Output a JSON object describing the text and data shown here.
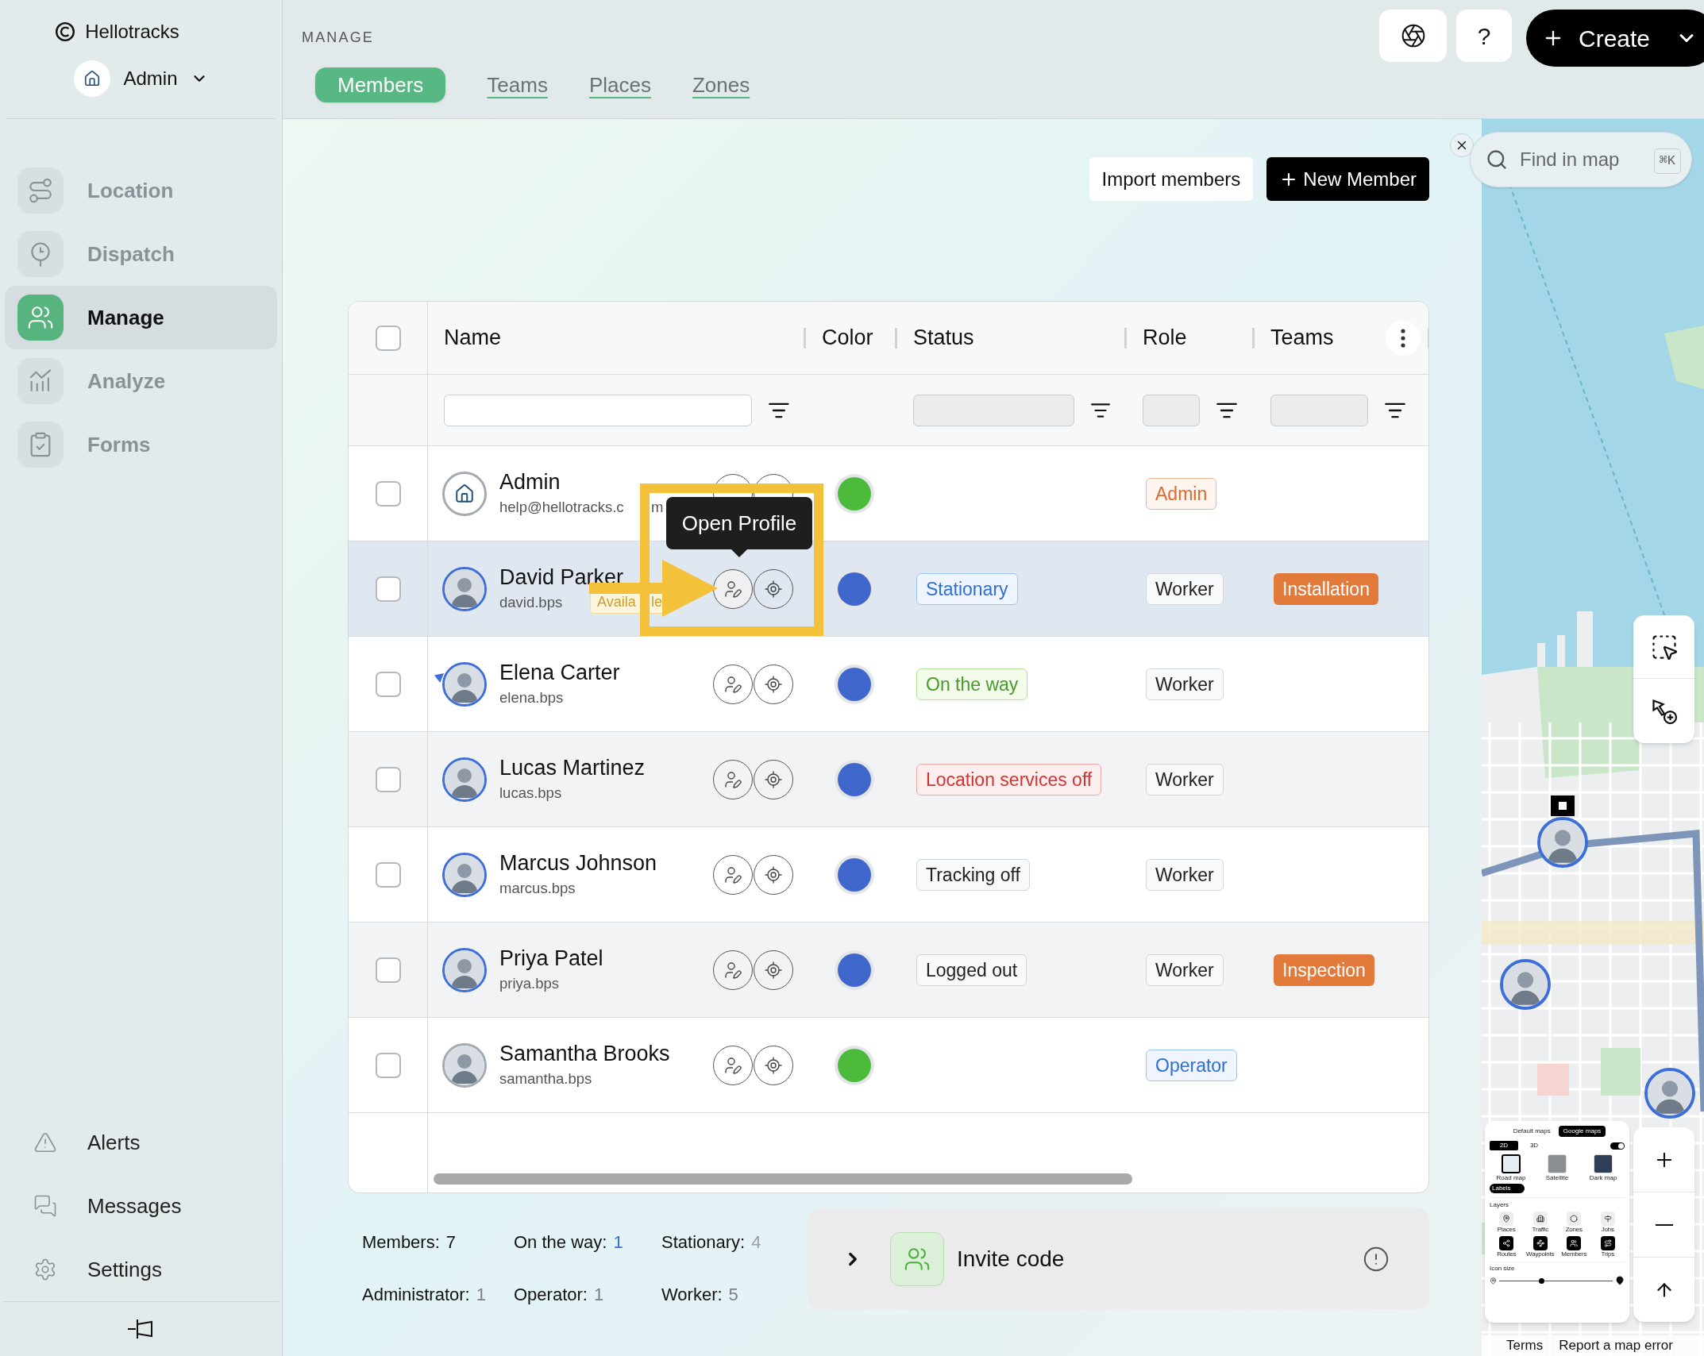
{
  "sidebar": {
    "brand": "Hellotracks",
    "account": "Admin",
    "nav": [
      {
        "label": "Location",
        "selected": false
      },
      {
        "label": "Dispatch",
        "selected": false
      },
      {
        "label": "Manage",
        "selected": true
      },
      {
        "label": "Analyze",
        "selected": false
      },
      {
        "label": "Forms",
        "selected": false
      }
    ],
    "footer_nav": [
      {
        "label": "Alerts"
      },
      {
        "label": "Messages"
      },
      {
        "label": "Settings"
      }
    ]
  },
  "header": {
    "section": "MANAGE",
    "tabs": [
      {
        "label": "Members",
        "selected": true
      },
      {
        "label": "Teams",
        "selected": false
      },
      {
        "label": "Places",
        "selected": false
      },
      {
        "label": "Zones",
        "selected": false
      }
    ],
    "help": "?",
    "create": "Create"
  },
  "actions": {
    "import": "Import members",
    "new_member": "New Member"
  },
  "table": {
    "select_all_checked": false,
    "columns": [
      {
        "label": "Name",
        "filter_disabled": false
      },
      {
        "label": "Color"
      },
      {
        "label": "Status",
        "filter_disabled": true
      },
      {
        "label": "Role",
        "filter_disabled": true
      },
      {
        "label": "Teams",
        "filter_disabled": true
      }
    ],
    "rows": [
      {
        "name": "Admin",
        "subtitle_parts": [
          "help@hellotracks.c",
          "m"
        ],
        "checked": false,
        "selected": false,
        "avatar": {
          "kind": "logo",
          "color": "#a3aab2"
        },
        "direction_marker": false,
        "color": "#4cbb3c",
        "role": {
          "text": "Admin",
          "kind": "admin"
        }
      },
      {
        "name": "David Parker",
        "subtitle_parts": [
          "david.bps"
        ],
        "badge_parts": [
          "Availa",
          "le"
        ],
        "checked": false,
        "selected": true,
        "avatar": {
          "kind": "person",
          "color": "#3e6fd8"
        },
        "direction_marker": false,
        "color": "#3f67cc",
        "status": {
          "text": "Stationary",
          "kind": "info"
        },
        "role": {
          "text": "Worker",
          "kind": "neutral"
        },
        "team": "Installation"
      },
      {
        "name": "Elena Carter",
        "subtitle_parts": [
          "elena.bps"
        ],
        "checked": false,
        "selected": false,
        "avatar": {
          "kind": "person",
          "color": "#3e6fd8"
        },
        "direction_marker": true,
        "color": "#3f67cc",
        "status": {
          "text": "On the way",
          "kind": "success"
        },
        "role": {
          "text": "Worker",
          "kind": "neutral"
        }
      },
      {
        "name": "Lucas Martinez",
        "subtitle_parts": [
          "lucas.bps"
        ],
        "checked": false,
        "selected": false,
        "avatar": {
          "kind": "person",
          "color": "#3e6fd8"
        },
        "direction_marker": false,
        "color": "#3f67cc",
        "status": {
          "text": "Location services off",
          "kind": "danger"
        },
        "role": {
          "text": "Worker",
          "kind": "neutral"
        }
      },
      {
        "name": "Marcus Johnson",
        "subtitle_parts": [
          "marcus.bps"
        ],
        "checked": false,
        "selected": false,
        "avatar": {
          "kind": "person",
          "color": "#3e6fd8"
        },
        "direction_marker": false,
        "color": "#3f67cc",
        "status": {
          "text": "Tracking off",
          "kind": "neutral"
        },
        "role": {
          "text": "Worker",
          "kind": "neutral"
        }
      },
      {
        "name": "Priya Patel",
        "subtitle_parts": [
          "priya.bps"
        ],
        "checked": false,
        "selected": false,
        "avatar": {
          "kind": "person",
          "color": "#3e6fd8"
        },
        "direction_marker": false,
        "color": "#3f67cc",
        "status": {
          "text": "Logged out",
          "kind": "neutral"
        },
        "role": {
          "text": "Worker",
          "kind": "neutral"
        },
        "team": "Inspection"
      },
      {
        "name": "Samantha Brooks",
        "subtitle_parts": [
          "samantha.bps"
        ],
        "checked": false,
        "selected": false,
        "avatar": {
          "kind": "person",
          "color": "#a3aab2"
        },
        "direction_marker": false,
        "color": "#4cbb3c",
        "role": {
          "text": "Operator",
          "kind": "info"
        }
      }
    ]
  },
  "tooltip": "Open Profile",
  "stats": [
    {
      "label": "Members:",
      "value": "7",
      "color": "#111111"
    },
    {
      "label": "On the way:",
      "value": "1",
      "color": "#3b6fd6"
    },
    {
      "label": "Stationary:",
      "value": "4",
      "color": "#9a9fa5"
    },
    {
      "label": "Administrator:",
      "value": "1",
      "color": "#7b8086"
    },
    {
      "label": "Operator:",
      "value": "1",
      "color": "#7b8086"
    },
    {
      "label": "Worker:",
      "value": "5",
      "color": "#7b8086"
    }
  ],
  "invite": {
    "label": "Invite code"
  },
  "map": {
    "search_placeholder": "Find in map",
    "shortcut": "⌘K",
    "layers_panel": {
      "map_types": [
        {
          "label": "Default maps",
          "selected": false
        },
        {
          "label": "Google maps",
          "selected": true
        }
      ],
      "modes": [
        {
          "label": "2D",
          "selected": true
        },
        {
          "label": "3D",
          "selected": false
        }
      ],
      "mode_toggle_on": true,
      "base_maps": [
        {
          "label": "Road map",
          "selected": true
        },
        {
          "label": "Satellite",
          "selected": false
        },
        {
          "label": "Dark map",
          "selected": false
        }
      ],
      "labels": {
        "label": "Labels",
        "on": true
      },
      "layers_title": "Layers",
      "layers": [
        {
          "label": "Places",
          "on": false
        },
        {
          "label": "Traffic",
          "on": false
        },
        {
          "label": "Zones",
          "on": false
        },
        {
          "label": "Jobs",
          "on": false
        },
        {
          "label": "Routes",
          "on": true
        },
        {
          "label": "Waypoints",
          "on": true
        },
        {
          "label": "Members",
          "on": true
        },
        {
          "label": "Trips",
          "on": true
        }
      ],
      "icon_size": {
        "label": "Icon size",
        "level": 0.37
      }
    },
    "footer": [
      "Terms",
      "Report a map error"
    ]
  }
}
